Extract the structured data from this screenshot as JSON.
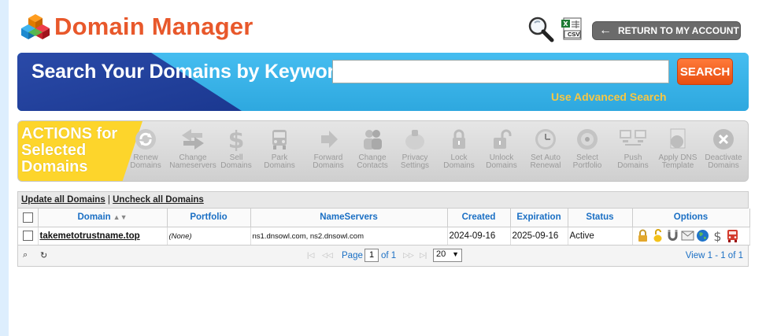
{
  "header": {
    "title": "Domain Manager",
    "return_label": "RETURN TO MY ACCOUNT",
    "csv_label": "CSV"
  },
  "search": {
    "heading": "Search Your Domains by Keyword",
    "value": "",
    "button_label": "SEARCH",
    "advanced_label": "Use Advanced Search"
  },
  "actions": {
    "heading": "ACTIONS for\nSelected\nDomains",
    "items": [
      {
        "label": "Renew Domains",
        "icon": "renew-icon"
      },
      {
        "label": "Change Nameservers",
        "icon": "change-nameservers-icon"
      },
      {
        "label": "Sell Domains",
        "icon": "dollar-icon"
      },
      {
        "label": "Park Domains",
        "icon": "park-icon"
      },
      {
        "label": "Forward Domains",
        "icon": "forward-arrow-icon"
      },
      {
        "label": "Change Contacts",
        "icon": "contacts-icon"
      },
      {
        "label": "Privacy Settings",
        "icon": "privacy-icon"
      },
      {
        "label": "Lock Domains",
        "icon": "lock-icon"
      },
      {
        "label": "Unlock Domains",
        "icon": "unlock-icon"
      },
      {
        "label": "Set Auto Renewal",
        "icon": "clock-icon"
      },
      {
        "label": "Select Portfolio",
        "icon": "portfolio-icon"
      },
      {
        "label": "Push Domains",
        "icon": "push-icon"
      },
      {
        "label": "Apply DNS Template",
        "icon": "dns-template-icon"
      },
      {
        "label": "Deactivate Domains",
        "icon": "deactivate-icon"
      }
    ]
  },
  "grid": {
    "update_all_label": "Update all Domains",
    "separator": "|",
    "uncheck_all_label": "Uncheck all Domains",
    "columns": [
      "Domain",
      "Portfolio",
      "NameServers",
      "Created",
      "Expiration",
      "Status",
      "Options"
    ],
    "rows": [
      {
        "domain": "takemetotrustname.top",
        "portfolio": "(None)",
        "nameservers": "ns1.dnsowl.com, ns2.dnsowl.com",
        "created": "2024-09-16",
        "expiration": "2025-09-16",
        "status": "Active"
      }
    ],
    "pager": {
      "page_label": "Page",
      "page_value": "1",
      "of_label": "of 1",
      "rows_per_page": "20",
      "view_label": "View 1 - 1 of 1"
    }
  }
}
